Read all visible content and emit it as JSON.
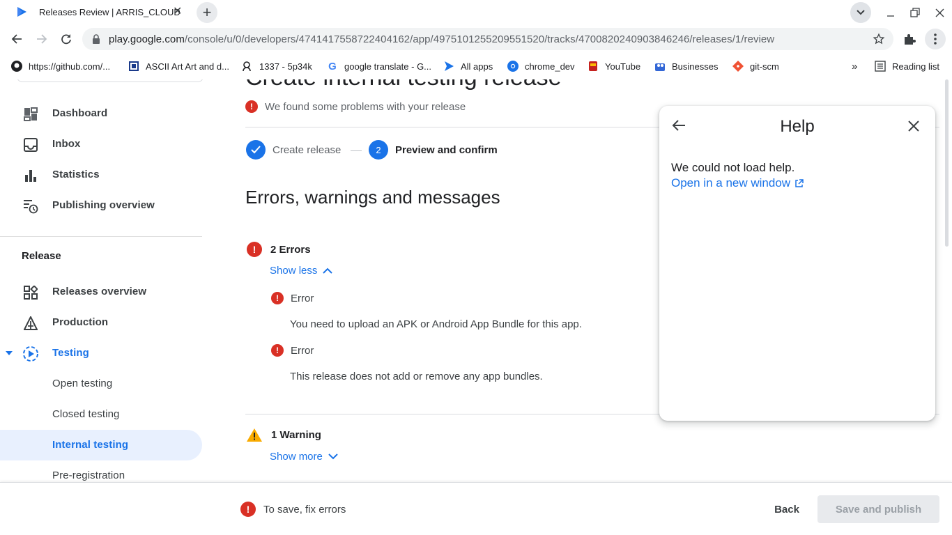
{
  "browser": {
    "tab_title": "Releases Review | ARRIS_CLOUD",
    "url_host": "play.google.com",
    "url_path": "/console/u/0/developers/4741417558722404162/app/4975101255209551520/tracks/4700820240903846246/releases/1/review",
    "bookmarks": [
      {
        "label": "https://github.com/...",
        "icon": "github-icon"
      },
      {
        "label": "ASCII Art Art and d...",
        "icon": "ascii-icon"
      },
      {
        "label": "1337 - 5p34k",
        "icon": "leet-icon"
      },
      {
        "label": "google translate - G...",
        "icon": "google-icon"
      },
      {
        "label": "All apps",
        "icon": "play-console-icon"
      },
      {
        "label": "chrome_dev",
        "icon": "chrome-dev-icon"
      },
      {
        "label": "YouTube",
        "icon": "youtube-icon"
      },
      {
        "label": "Businesses",
        "icon": "business-icon"
      },
      {
        "label": "git-scm",
        "icon": "git-icon"
      }
    ],
    "more_bookmarks": "»",
    "reading_list": "Reading list"
  },
  "sidebar": {
    "items_top": [
      {
        "label": "Dashboard",
        "icon": "dashboard-icon"
      },
      {
        "label": "Inbox",
        "icon": "inbox-icon"
      },
      {
        "label": "Statistics",
        "icon": "statistics-icon"
      },
      {
        "label": "Publishing overview",
        "icon": "publishing-overview-icon"
      }
    ],
    "section": "Release",
    "items_release": [
      {
        "label": "Releases overview",
        "icon": "releases-overview-icon"
      },
      {
        "label": "Production",
        "icon": "production-icon"
      },
      {
        "label": "Testing",
        "icon": "testing-icon"
      }
    ],
    "testing_sub": [
      {
        "label": "Open testing"
      },
      {
        "label": "Closed testing"
      },
      {
        "label": "Internal testing",
        "active": true
      },
      {
        "label": "Pre-registration"
      }
    ]
  },
  "main": {
    "page_title": "Create internal testing release",
    "problems": "We found some problems with your release",
    "step1": "Create release",
    "step2_num": "2",
    "step2": "Preview and confirm",
    "section_title": "Errors, warnings and messages",
    "errors_head": "2 Errors",
    "show_less": "Show less",
    "errors": [
      {
        "title": "Error",
        "message": "You need to upload an APK or Android App Bundle for this app."
      },
      {
        "title": "Error",
        "message": "This release does not add or remove any app bundles."
      }
    ],
    "warnings_head": "1 Warning",
    "show_more": "Show more"
  },
  "help": {
    "title": "Help",
    "message": "We could not load help.",
    "link": "Open in a new window"
  },
  "bottom": {
    "fix_msg": "To save, fix errors",
    "back": "Back",
    "save": "Save and publish"
  },
  "colors": {
    "accent": "#1a73e8",
    "error": "#d93025",
    "warning": "#f9ab00"
  }
}
